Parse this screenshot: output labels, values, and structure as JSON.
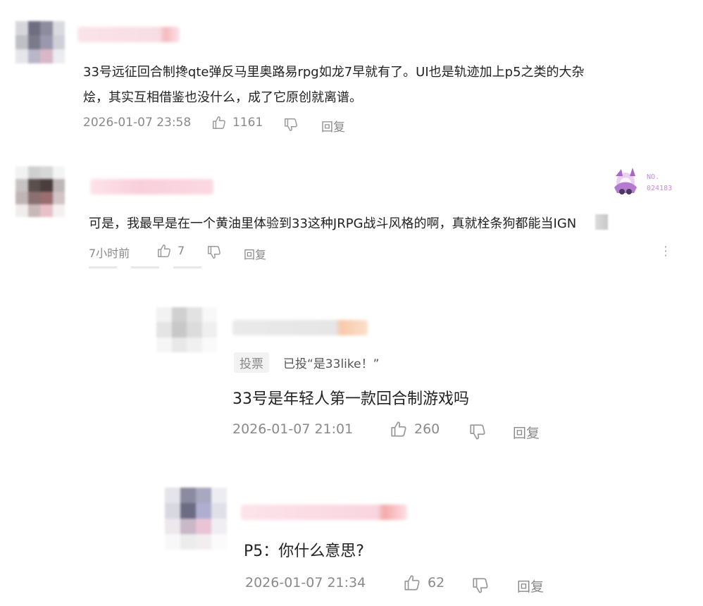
{
  "comments": [
    {
      "text_line1": "33号远征回合制搀qte弹反马里奥路易rpg如龙7早就有了。UI也是轨迹加上p5之类的大杂",
      "text_line2": "烩，其实互相借鉴也没什么，成了它原创就离谱。",
      "time": "2026-01-07 23:58",
      "likes": "1161",
      "reply_label": "回复"
    },
    {
      "text": "可是，我最早是在一个黄油里体验到33这种JRPG战斗风格的啊，真就栓条狗都能当IGN",
      "time": "7小时前",
      "likes": "7",
      "reply_label": "回复",
      "badge_no": "NO.",
      "badge_num": "024183",
      "more": "⋮"
    },
    {
      "vote_tag": "投票",
      "vote_text": "已投“是33like！”",
      "text": "33号是年轻人第一款回合制游戏吗",
      "time": "2026-01-07 21:01",
      "likes": "260",
      "reply_label": "回复"
    },
    {
      "text": "P5：你什么意思?",
      "time": "2026-01-07 21:34",
      "likes": "62",
      "reply_label": "回复"
    }
  ]
}
